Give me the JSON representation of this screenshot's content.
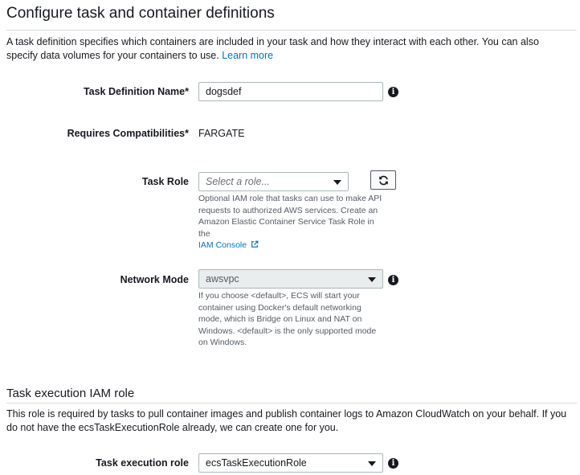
{
  "section1": {
    "title": "Configure task and container definitions",
    "description": "A task definition specifies which containers are included in your task and how they interact with each other. You can also specify data volumes for your containers to use.",
    "learn_more": "Learn more"
  },
  "task_definition_name": {
    "label": "Task Definition Name*",
    "value": "dogsdef"
  },
  "requires_compatibilities": {
    "label": "Requires Compatibilities*",
    "value": "FARGATE"
  },
  "task_role": {
    "label": "Task Role",
    "placeholder": "Select a role...",
    "help": "Optional IAM role that tasks can use to make API requests to authorized AWS services. Create an Amazon Elastic Container Service Task Role in the",
    "help_link": "IAM Console"
  },
  "network_mode": {
    "label": "Network Mode",
    "value": "awsvpc",
    "help": "If you choose <default>, ECS will start your container using Docker's default networking mode, which is Bridge on Linux and NAT on Windows. <default> is the only supported mode on Windows."
  },
  "section2": {
    "title": "Task execution IAM role",
    "description": "This role is required by tasks to pull container images and publish container logs to Amazon CloudWatch on your behalf. If you do not have the ecsTaskExecutionRole already, we can create one for you."
  },
  "task_execution_role": {
    "label": "Task execution role",
    "value": "ecsTaskExecutionRole"
  },
  "icons": {
    "info": "i"
  },
  "colors": {
    "link": "#0073bb",
    "text": "#16191f",
    "border": "#aab7b8",
    "disabled_bg": "#eaeded"
  }
}
